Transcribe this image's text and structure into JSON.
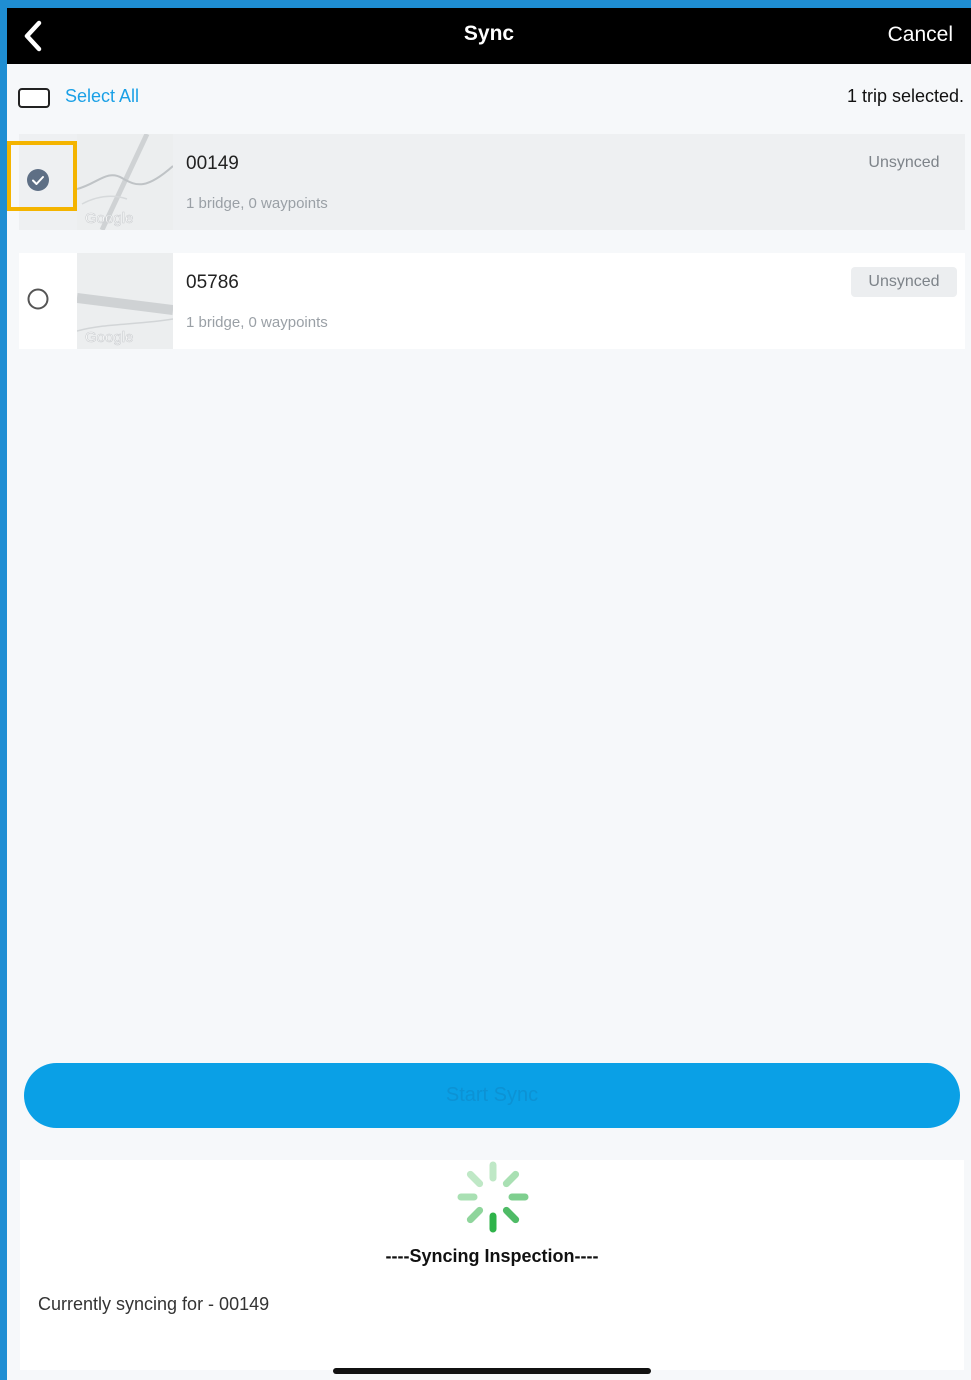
{
  "header": {
    "title": "Sync",
    "back_icon": "chevron-left-icon",
    "cancel_label": "Cancel"
  },
  "selection": {
    "select_all_label": "Select All",
    "count_text": "1 trip selected."
  },
  "trips": [
    {
      "name": "00149",
      "detail": "1 bridge, 0 waypoints",
      "status": "Unsynced",
      "selected": true,
      "map_watermark": "Google"
    },
    {
      "name": "05786",
      "detail": "1 bridge, 0 waypoints",
      "status": "Unsynced",
      "selected": false,
      "map_watermark": "Google"
    }
  ],
  "start_button": {
    "label": "Start Sync"
  },
  "sync_panel": {
    "spinner_icon": "loading-spinner-icon",
    "title": "----Syncing Inspection----",
    "status": "Currently syncing for - 00149"
  },
  "colors": {
    "accent": "#0aa0e6",
    "navbar": "#000000",
    "highlight": "#f4b400",
    "spinner": "#2fb34a",
    "frame_border": "#1f8ed3"
  }
}
